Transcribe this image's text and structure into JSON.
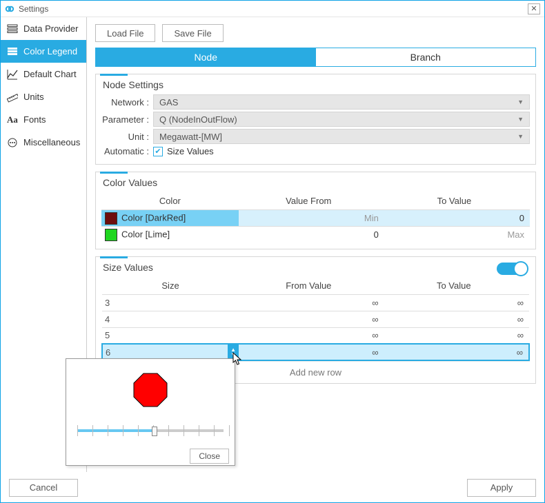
{
  "window": {
    "title": "Settings"
  },
  "sidebar": {
    "items": [
      {
        "label": "Data Provider"
      },
      {
        "label": "Color Legend"
      },
      {
        "label": "Default Chart"
      },
      {
        "label": "Units"
      },
      {
        "label": "Fonts"
      },
      {
        "label": "Miscellaneous"
      }
    ]
  },
  "toolbar": {
    "load": "Load File",
    "save": "Save File"
  },
  "tabs": {
    "node": "Node",
    "branch": "Branch"
  },
  "node_settings": {
    "title": "Node Settings",
    "network_label": "Network :",
    "network_value": "GAS",
    "parameter_label": "Parameter :",
    "parameter_value": "Q (NodeInOutFlow)",
    "unit_label": "Unit :",
    "unit_value": "Megawatt-[MW]",
    "automatic_label": "Automatic :",
    "automatic_check_label": "Size Values"
  },
  "color_values": {
    "title": "Color Values",
    "col_color": "Color",
    "col_from": "Value From",
    "col_to": "To Value",
    "rows": [
      {
        "swatch": "#6e0d0d",
        "label": "Color [DarkRed]",
        "from": "Min",
        "to": "0"
      },
      {
        "swatch": "#1fd61f",
        "label": "Color [Lime]",
        "from": "0",
        "to": "Max"
      }
    ]
  },
  "size_values": {
    "title": "Size Values",
    "col_size": "Size",
    "col_from": "From Value",
    "col_to": "To Value",
    "rows": [
      {
        "size": "3",
        "from": "∞",
        "to": "∞"
      },
      {
        "size": "4",
        "from": "∞",
        "to": "∞"
      },
      {
        "size": "5",
        "from": "∞",
        "to": "∞"
      },
      {
        "size": "6",
        "from": "∞",
        "to": "∞"
      }
    ],
    "add_row": "Add new row"
  },
  "popup": {
    "close": "Close",
    "slider_value": 0.5,
    "shape_color": "#ff0000"
  },
  "footer": {
    "cancel": "Cancel",
    "apply": "Apply"
  }
}
